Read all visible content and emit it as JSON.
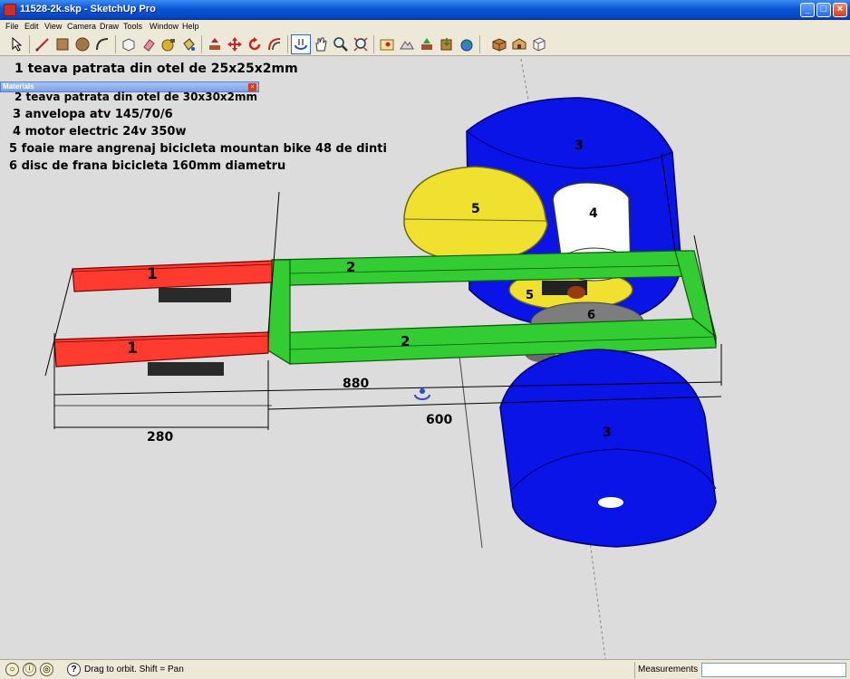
{
  "window": {
    "title": "11528-2k.skp - SketchUp Pro"
  },
  "menu": [
    "File",
    "Edit",
    "View",
    "Camera",
    "Draw",
    "Tools",
    "Window",
    "Help"
  ],
  "toolbar": [
    "select-icon",
    "line-icon",
    "rectangle-icon",
    "circle-icon",
    "arc-icon",
    "make-component-icon",
    "eraser-icon",
    "tape-measure-icon",
    "paint-bucket-icon",
    "push-pull-icon",
    "move-icon",
    "rotate-icon",
    "offset-icon",
    "orbit-icon",
    "pan-icon",
    "zoom-icon",
    "zoom-extents-icon",
    "add-location-icon",
    "terrain-icon",
    "photo-textures-icon",
    "get-models-icon",
    "share-model-icon",
    "components-icon",
    "3d-warehouse-icon",
    "layout-icon"
  ],
  "materials_panel": {
    "title": "Materials",
    "close": "×"
  },
  "notes": [
    "1 teava patrata din otel de 25x25x2mm",
    "2 teava patrata din otel de 30x30x2mm",
    "3 anvelopa atv 145/70/6",
    "4 motor electric 24v 350w",
    "5 foaie mare angrenaj bicicleta mountan bike 48 de dinti",
    "6 disc de frana bicicleta 160mm diametru"
  ],
  "model_labels": {
    "tube1_top": "1",
    "tube1_bottom": "1",
    "tube2_top": "2",
    "tube2_bottom": "2",
    "tire_top": "3",
    "tire_bottom": "3",
    "motor": "4",
    "gear_big": "5",
    "gear_small": "5",
    "disc": "6"
  },
  "dimensions": {
    "d880": "880",
    "d600": "600",
    "d280": "280"
  },
  "status": {
    "hint": "Drag to orbit.  Shift = Pan",
    "measurements_label": "Measurements",
    "measurements_value": ""
  },
  "colors": {
    "red_tube": "#ff3b30",
    "green_frame": "#33cc33",
    "blue_tire": "#0a14e6",
    "yellow_gear": "#f0e030",
    "gray_disc": "#7d7d7d",
    "viewport_bg": "#dcdcdc"
  }
}
